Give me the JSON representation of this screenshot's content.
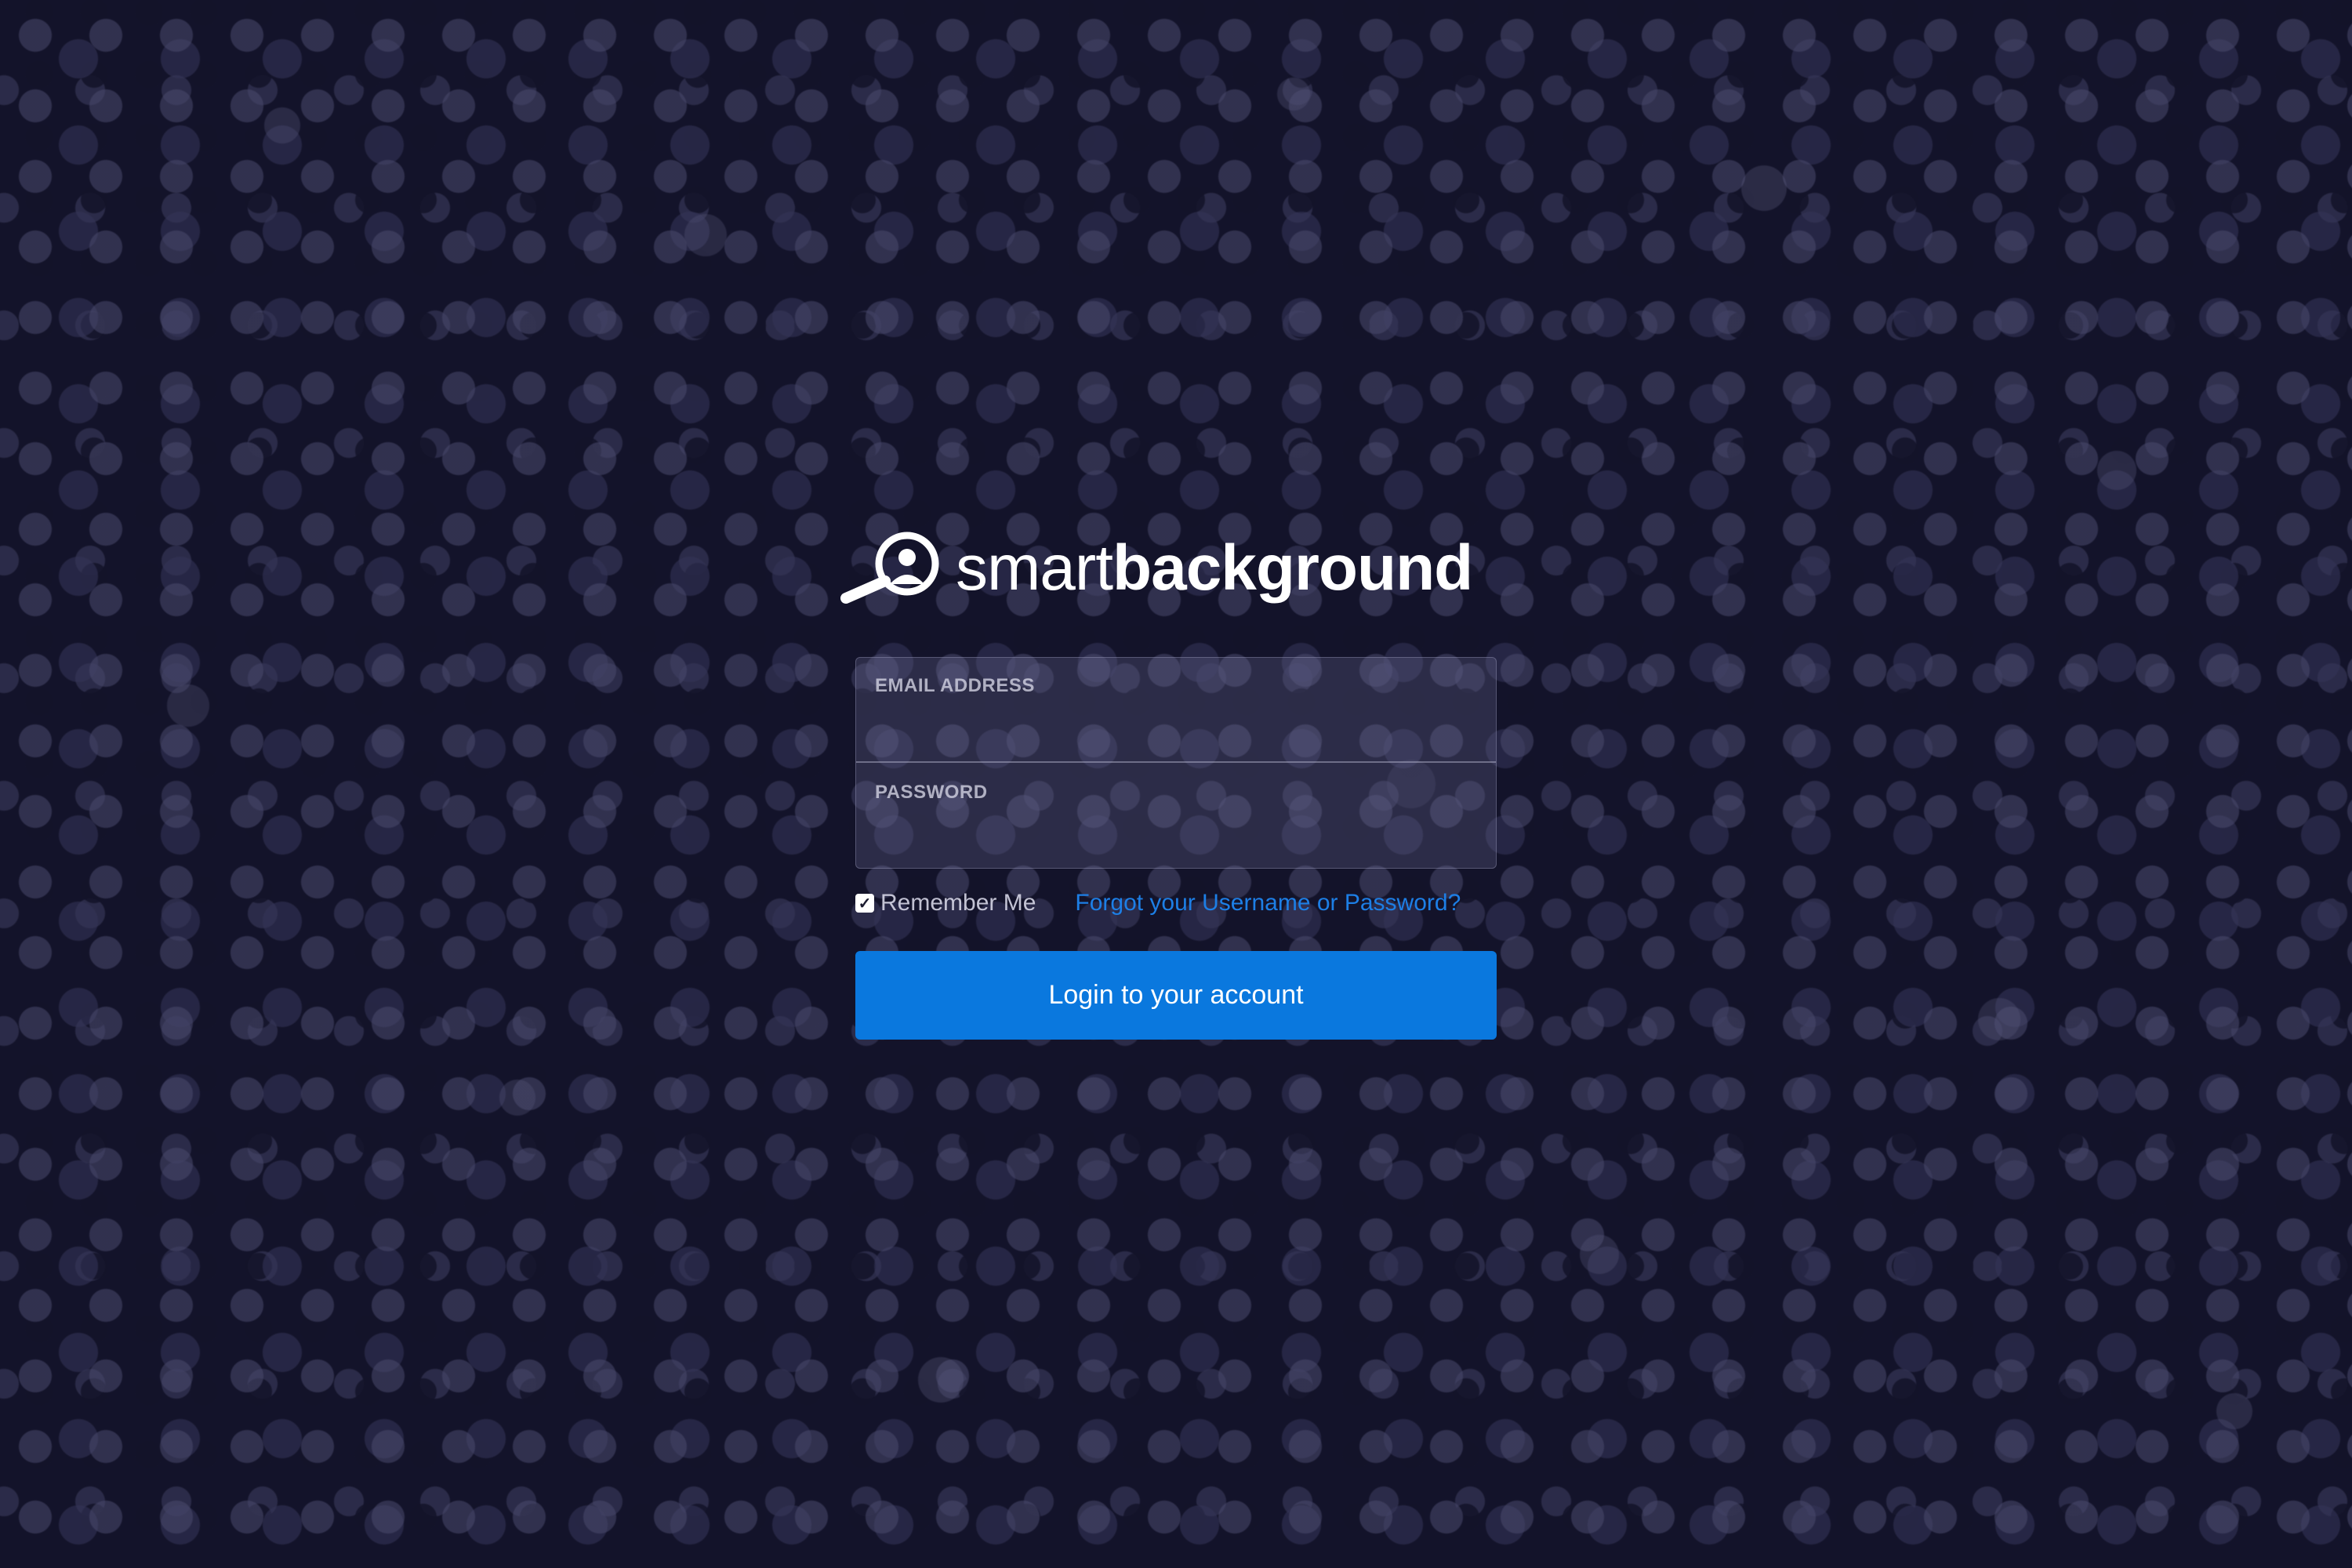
{
  "brand": {
    "name_light": "smart",
    "name_bold": "background",
    "logo_icon": "magnifier-person-icon"
  },
  "form": {
    "email_label": "EMAIL ADDRESS",
    "email_value": "",
    "password_label": "PASSWORD",
    "password_value": "",
    "remember_label": "Remember Me",
    "remember_checked": true,
    "forgot_link": "Forgot your Username or Password?",
    "submit_label": "Login to your account"
  },
  "colors": {
    "accent": "#0a78de",
    "link": "#1d7fe6",
    "background": "#15152a"
  }
}
